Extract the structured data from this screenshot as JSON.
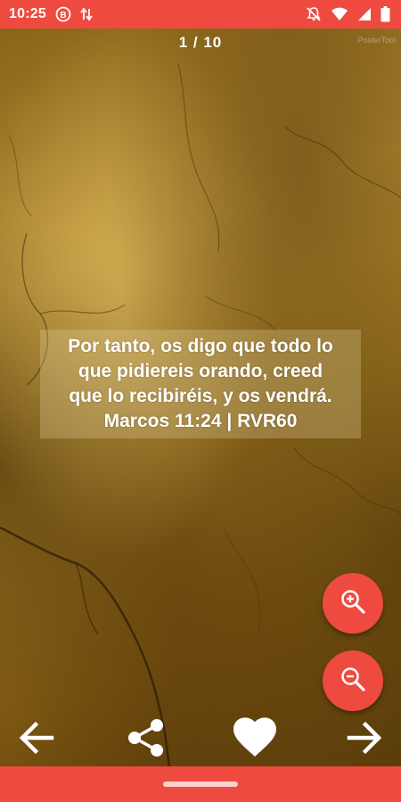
{
  "status_bar": {
    "time": "10:25",
    "icons": [
      "b-notification-icon",
      "data-transfer-icon",
      "mute-icon",
      "wifi-icon",
      "signal-icon",
      "battery-icon"
    ]
  },
  "viewer": {
    "counter": "1 / 10",
    "watermark": "PosterTool",
    "verse": {
      "lines": [
        "Por tanto, os digo que todo lo",
        "que pidiereis orando, creed",
        "que lo recibiréis, y os vendrá."
      ],
      "reference": "Marcos 11:24 | RVR60"
    }
  },
  "buttons": {
    "zoom_in": "zoom-in-icon",
    "zoom_out": "zoom-out-icon",
    "previous": "arrow-left-icon",
    "share": "share-icon",
    "favorite": "heart-icon",
    "next": "arrow-right-icon"
  },
  "colors": {
    "accent": "#ef4a3f",
    "text": "#ffffff"
  }
}
